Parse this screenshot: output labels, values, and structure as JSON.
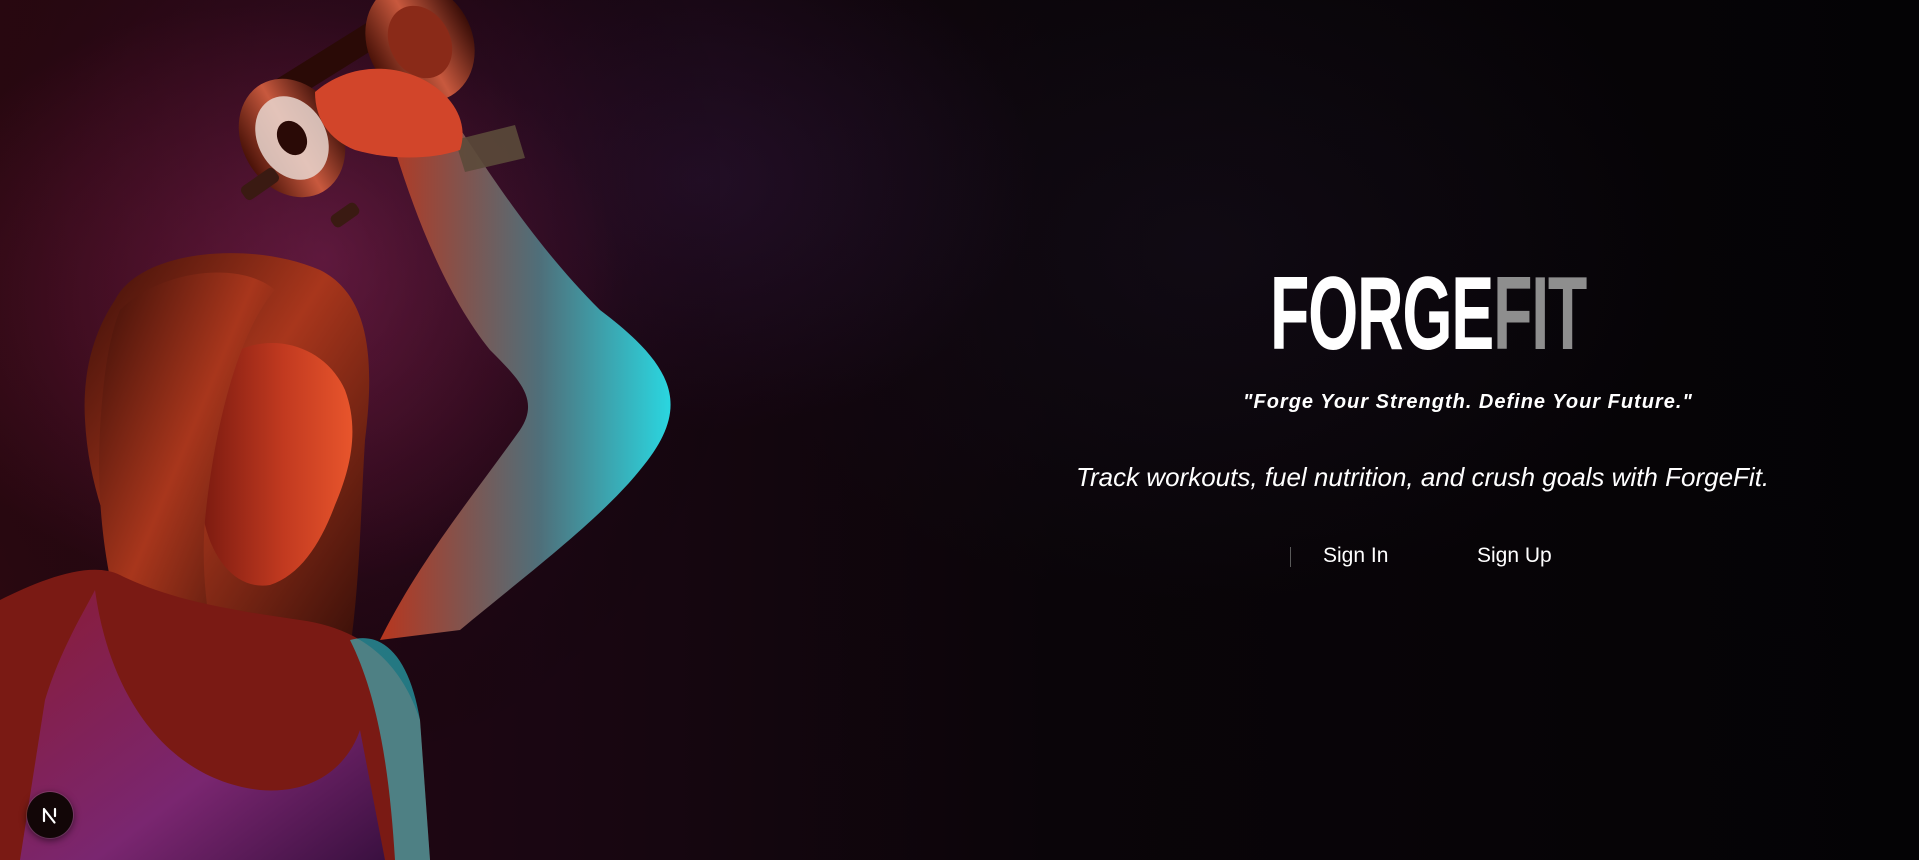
{
  "brand": {
    "logo_part1": "FORGE",
    "logo_part2": "FIT",
    "logo_color_primary": "#ffffff",
    "logo_color_accent": "#8e8e8e",
    "tagline": "\"Forge Your Strength. Define Your Future.\"",
    "subtitle": "Track workouts, fuel nutrition, and crush goals with ForgeFit."
  },
  "auth": {
    "sign_in_label": "Sign In",
    "sign_up_label": "Sign Up"
  },
  "badge": {
    "icon": "nextjs-n-icon"
  },
  "hero": {
    "image": "athlete-with-dumbbell-photo",
    "glow_colors": [
      "#e8321e",
      "#2ad6e0",
      "#8a2a6a"
    ]
  }
}
